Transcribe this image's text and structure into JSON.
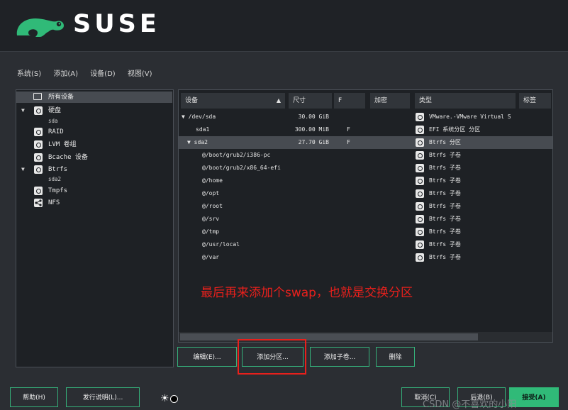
{
  "header": {
    "brand": "SUSE"
  },
  "menubar": {
    "items": [
      "系统(S)",
      "添加(A)",
      "设备(D)",
      "视图(V)"
    ]
  },
  "tree": {
    "items": [
      {
        "label": "所有设备",
        "selected": true
      },
      {
        "label": "硬盘",
        "expanded": true
      },
      {
        "label": "sda"
      },
      {
        "label": "RAID"
      },
      {
        "label": "LVM 卷组"
      },
      {
        "label": "Bcache 设备"
      },
      {
        "label": "Btrfs",
        "expanded": true
      },
      {
        "label": "sda2"
      },
      {
        "label": "Tmpfs"
      },
      {
        "label": "NFS"
      }
    ]
  },
  "table": {
    "columns": [
      "设备",
      "尺寸",
      "F",
      "加密",
      "类型",
      "标签"
    ],
    "sort_indicator": "▲",
    "rows": [
      {
        "device": "▼ /dev/sda",
        "size": "30.00 GiB",
        "f": "",
        "type": "VMware.-VMware Virtual S"
      },
      {
        "device": "sda1",
        "size": "300.00 MiB",
        "f": "F",
        "type": "EFI 系统分区 分区"
      },
      {
        "device": "▼ sda2",
        "size": "27.70 GiB",
        "f": "F",
        "type": "Btrfs 分区",
        "selected": true
      },
      {
        "device": "@/boot/grub2/i386-pc",
        "size": "",
        "f": "",
        "type": "Btrfs 子卷"
      },
      {
        "device": "@/boot/grub2/x86_64-efi",
        "size": "",
        "f": "",
        "type": "Btrfs 子卷"
      },
      {
        "device": "@/home",
        "size": "",
        "f": "",
        "type": "Btrfs 子卷"
      },
      {
        "device": "@/opt",
        "size": "",
        "f": "",
        "type": "Btrfs 子卷"
      },
      {
        "device": "@/root",
        "size": "",
        "f": "",
        "type": "Btrfs 子卷"
      },
      {
        "device": "@/srv",
        "size": "",
        "f": "",
        "type": "Btrfs 子卷"
      },
      {
        "device": "@/tmp",
        "size": "",
        "f": "",
        "type": "Btrfs 子卷"
      },
      {
        "device": "@/usr/local",
        "size": "",
        "f": "",
        "type": "Btrfs 子卷"
      },
      {
        "device": "@/var",
        "size": "",
        "f": "",
        "type": "Btrfs 子卷"
      }
    ]
  },
  "annotation": "最后再来添加个swap，也就是交换分区",
  "actions": {
    "edit": "编辑(E)...",
    "add_partition": "添加分区...",
    "add_subvolume": "添加子卷...",
    "delete": "删除"
  },
  "footer": {
    "help": "帮助(H)",
    "release_notes": "发行说明(L)...",
    "theme_icon": "☀",
    "cancel": "取消(C)",
    "back": "后退(B)",
    "accept": "接受(A)",
    "watermark": "CSDN @不喜欢的小阳"
  },
  "colors": {
    "accent": "#30ba78",
    "annotation": "#e8201c"
  }
}
